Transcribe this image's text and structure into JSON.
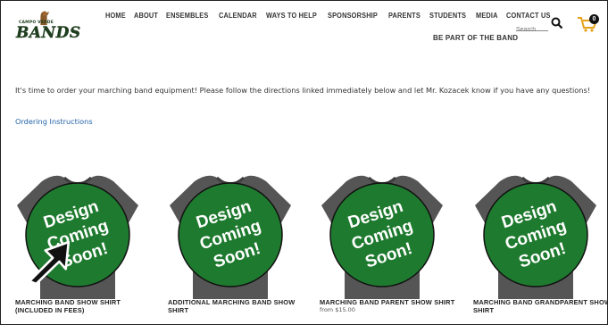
{
  "brand": {
    "logo_small": "CAMPO VERDE",
    "logo_big": "BANDS"
  },
  "nav": {
    "items": [
      "HOME",
      "ABOUT",
      "ENSEMBLES",
      "CALENDAR",
      "WAYS TO HELP",
      "SPONSORSHIP",
      "PARENTS",
      "STUDENTS",
      "MEDIA",
      "CONTACT US"
    ],
    "secondary": "BE PART OF THE BAND"
  },
  "search": {
    "placeholder": "Search"
  },
  "cart": {
    "count": "0"
  },
  "content": {
    "intro": "It's time to order your marching band equipment! Please follow the directions linked immediately below and let Mr. Kozacek know if you have any questions!",
    "link": "Ordering Instructions"
  },
  "products": [
    {
      "name": "MARCHING BAND SHOW SHIRT (INCLUDED IN FEES)",
      "price": "",
      "badge": "Design Coming Soon!"
    },
    {
      "name": "ADDITIONAL MARCHING BAND SHOW SHIRT",
      "price": "",
      "badge": "Design Coming Soon!"
    },
    {
      "name": "MARCHING BAND PARENT SHOW SHIRT",
      "price": "from $15.00",
      "badge": "Design Coming Soon!"
    },
    {
      "name": "MARCHING BAND GRANDPARENT SHOW SHIRT",
      "price": "",
      "badge": "Design Coming Soon!"
    }
  ],
  "colors": {
    "badge_green": "#1e7a2e",
    "link_blue": "#2464a8"
  },
  "icons": {
    "search": "search-icon",
    "cart": "cart-icon",
    "cursor": "arrow-cursor-icon"
  }
}
